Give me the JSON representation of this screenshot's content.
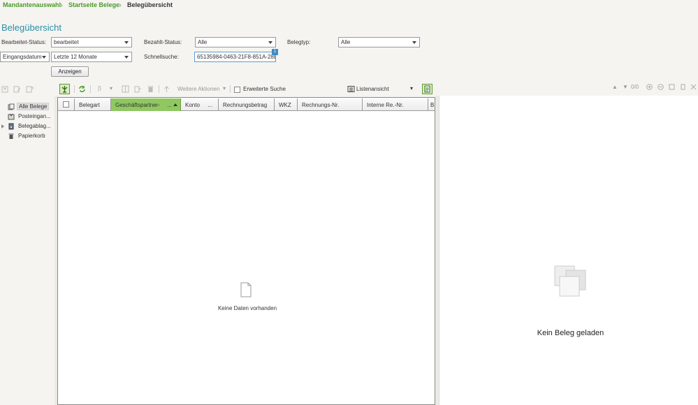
{
  "breadcrumb": {
    "items": [
      "Mandantenauswahl",
      "Startseite Belege",
      "Belegübersicht"
    ]
  },
  "page_title": "Belegübersicht",
  "filters": {
    "bearbeitet_label": "Bearbeitet-Status:",
    "bearbeitet_value": "bearbeitet",
    "bezahlt_label": "Bezahlt-Status:",
    "bezahlt_value": "Alle",
    "belegtyp_label": "Belegtyp:",
    "belegtyp_value": "Alle",
    "date_field_value": "Eingangsdatum",
    "period_value": "Letzte 12 Monate",
    "schnellsuche_label": "Schnellsuche:",
    "schnellsuche_value": "65135984-0463-21F8-851A-28E",
    "schnellsuche_badge": "1",
    "anzeigen_label": "Anzeigen"
  },
  "toolbar": {
    "weitere_aktionen": "Weitere Aktionen",
    "erweiterte_suche": "Erweiterte Suche",
    "listenansicht": "Listenansicht"
  },
  "tree": {
    "items": [
      "Alle Belege",
      "Posteingan...",
      "Belegablag...",
      "Papierkorb"
    ]
  },
  "grid": {
    "columns": [
      "Belegart",
      "Geschäftspartner-",
      "Konto",
      "Rechnungsbetrag",
      "WKZ",
      "Rechnungs-Nr.",
      "Interne Re.-Nr.",
      "B"
    ],
    "ellipsis": "...",
    "empty_text": "Keine Daten vorhanden"
  },
  "preview": {
    "counter": "0/0",
    "empty_text": "Kein Beleg geladen"
  },
  "colors": {
    "accent_green": "#4a9a2a",
    "title_teal": "#2a8fa8",
    "sorted_column": "#8fc860"
  }
}
